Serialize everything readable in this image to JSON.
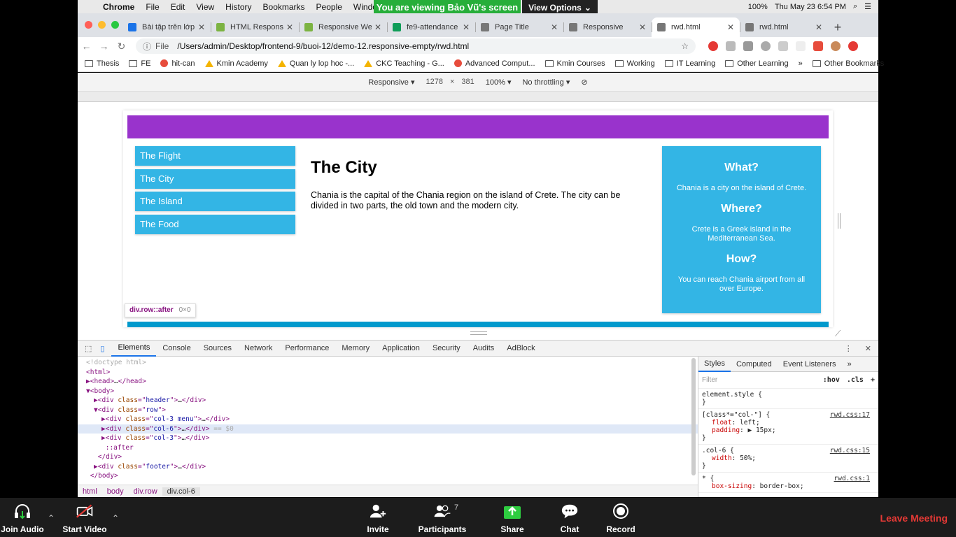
{
  "menubar": {
    "apple": "",
    "items": [
      "Chrome",
      "File",
      "Edit",
      "View",
      "History",
      "Bookmarks",
      "People",
      "Window"
    ],
    "status": [
      "100%",
      "Thu May 23  6:54 PM"
    ]
  },
  "zoom_banner": {
    "text": "You are viewing Bảo Vũ's screen",
    "view_options": "View Options"
  },
  "tabs": [
    {
      "title": "Bài tập trên lớp (",
      "color": "#1a73e8"
    },
    {
      "title": "HTML Responsiv",
      "color": "#7cb342"
    },
    {
      "title": "Responsive Web",
      "color": "#7cb342"
    },
    {
      "title": "fe9-attendance",
      "color": "#0f9d58"
    },
    {
      "title": "Page Title",
      "color": "#777777"
    },
    {
      "title": "Responsive",
      "color": "#777777"
    },
    {
      "title": "rwd.html",
      "color": "#777777",
      "active": true
    },
    {
      "title": "rwd.html",
      "color": "#777777"
    }
  ],
  "address": {
    "file_label": "File",
    "url": "/Users/admin/Desktop/frontend-9/buoi-12/demo-12.responsive-empty/rwd.html"
  },
  "bookmarks": [
    "Thesis",
    "FE",
    "hit-can",
    "Kmin Academy",
    "Quan ly lop hoc -...",
    "CKC Teaching - G...",
    "Advanced Comput...",
    "Kmin Courses",
    "Working",
    "IT Learning",
    "Other Learning"
  ],
  "bookmarks_more": "»",
  "other_bookmarks": "Other Bookmarks",
  "devicebar": {
    "device": "Responsive ▾",
    "width": "1278",
    "times": "×",
    "height": "381",
    "zoom": "100% ▾",
    "throttle": "No throttling ▾"
  },
  "page": {
    "menu": [
      "The Flight",
      "The City",
      "The Island",
      "The Food"
    ],
    "heading": "The City",
    "paragraph": "Chania is the capital of the Chania region on the island of Crete. The city can be divided in two parts, the old town and the modern city.",
    "aside": [
      {
        "h": "What?",
        "p": "Chania is a city on the island of Crete."
      },
      {
        "h": "Where?",
        "p": "Crete is a Greek island in the Mediterranean Sea."
      },
      {
        "h": "How?",
        "p": "You can reach Chania airport from all over Europe."
      }
    ],
    "colors": {
      "header": "#9933cc",
      "menu": "#33b5e5",
      "footer": "#0099cc"
    }
  },
  "tooltip": {
    "selector": "div.row::after",
    "size": "0×0"
  },
  "devtools": {
    "tabs": [
      "Elements",
      "Console",
      "Sources",
      "Network",
      "Performance",
      "Memory",
      "Application",
      "Security",
      "Audits",
      "AdBlock"
    ],
    "breadcrumbs": [
      "html",
      "body",
      "div.row",
      "div.col-6"
    ],
    "styles_tabs": [
      "Styles",
      "Computed",
      "Event Listeners",
      "»"
    ],
    "filter_placeholder": "Filter",
    "hov": ":hov",
    "cls": ".cls",
    "dom": [
      {
        "indent": 0,
        "html": "<span class='dim'>&lt;!doctype html&gt;</span>"
      },
      {
        "indent": 0,
        "html": "&lt;html&gt;"
      },
      {
        "indent": 0,
        "html": "▶&lt;head&gt;<span class='txt'>…</span>&lt;/head&gt;"
      },
      {
        "indent": 0,
        "html": "▼&lt;body&gt;"
      },
      {
        "indent": 1,
        "html": "▶&lt;div <span class='attr'>class</span>=\"<span class='val'>header</span>\"&gt;<span class='txt'>…</span>&lt;/div&gt;"
      },
      {
        "indent": 1,
        "html": "▼&lt;div <span class='attr'>class</span>=\"<span class='val'>row</span>\"&gt;"
      },
      {
        "indent": 2,
        "html": "▶&lt;div <span class='attr'>class</span>=\"<span class='val'>col-3 menu</span>\"&gt;<span class='txt'>…</span>&lt;/div&gt;"
      },
      {
        "indent": 2,
        "html": "▶&lt;div <span class='attr'>class</span>=\"<span class='val'>col-6</span>\"&gt;<span class='txt'>…</span>&lt;/div&gt; <span class='dim'>== $0</span>",
        "selected": true
      },
      {
        "indent": 2,
        "html": "▶&lt;div <span class='attr'>class</span>=\"<span class='val'>col-3</span>\"&gt;<span class='txt'>…</span>&lt;/div&gt;"
      },
      {
        "indent": 2,
        "html": " ::after"
      },
      {
        "indent": 1,
        "html": " &lt;/div&gt;"
      },
      {
        "indent": 1,
        "html": "▶&lt;div <span class='attr'>class</span>=\"<span class='val'>footer</span>\"&gt;<span class='txt'>…</span>&lt;/div&gt;"
      },
      {
        "indent": 0,
        "html": " &lt;/body&gt;"
      }
    ],
    "styles": [
      {
        "selector": "element.style {",
        "source": "",
        "props": [],
        "close": "}"
      },
      {
        "selector": "[class*=\"col-\"] {",
        "source": "rwd.css:17",
        "props": [
          [
            "float",
            "left;"
          ],
          [
            "padding",
            "▶ 15px;"
          ]
        ],
        "close": "}"
      },
      {
        "selector": ".col-6 {",
        "source": "rwd.css:15",
        "props": [
          [
            "width",
            "50%;"
          ]
        ],
        "close": "}"
      },
      {
        "selector": "* {",
        "source": "rwd.css:1",
        "props": [
          [
            "box-sizing",
            "border-box;"
          ]
        ],
        "close": ""
      }
    ]
  },
  "zoombar": {
    "join_audio": "Join Audio",
    "start_video": "Start Video",
    "invite": "Invite",
    "participants": "Participants",
    "participants_count": "7",
    "share": "Share",
    "chat": "Chat",
    "record": "Record",
    "leave": "Leave Meeting"
  }
}
